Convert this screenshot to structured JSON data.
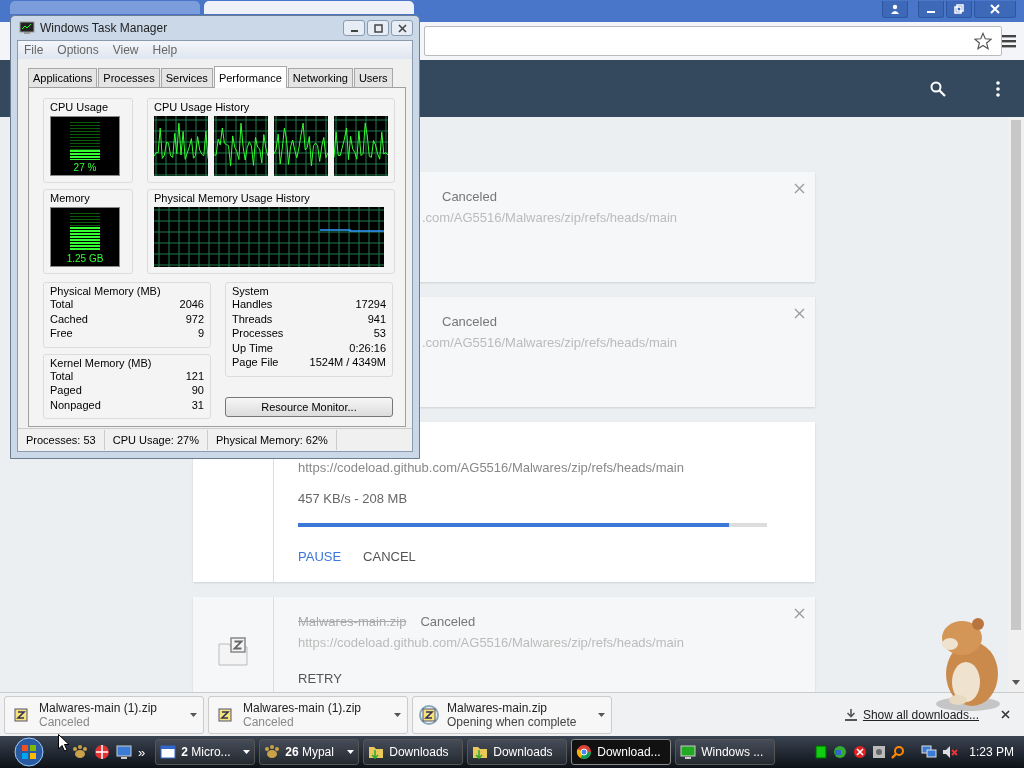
{
  "browser": {
    "downloads": [
      {
        "kind": "canceled",
        "status": "Canceled",
        "url": ".com/AG5516/Malwares/zip/refs/heads/main",
        "closable": true
      },
      {
        "kind": "canceled",
        "status": "Canceled",
        "url": ".com/AG5516/Malwares/zip/refs/heads/main",
        "closable": true
      },
      {
        "kind": "active",
        "url": "https://codeload.github.com/AG5516/Malwares/zip/refs/heads/main",
        "progress_text": "457 KB/s - 208 MB",
        "level": 0.92,
        "actions": [
          {
            "label": "PAUSE",
            "primary": true
          },
          {
            "label": "CANCEL",
            "primary": false
          }
        ]
      },
      {
        "kind": "canceled",
        "name": "Malwares-main.zip",
        "status": "Canceled",
        "url": "https://codeload.github.com/AG5516/Malwares/zip/refs/heads/main",
        "actions": [
          {
            "label": "RETRY",
            "primary": false
          }
        ],
        "closable": true
      }
    ],
    "shelf": {
      "items": [
        {
          "kind": "canceled",
          "name": "Malwares-main (1).zip",
          "status": "Canceled"
        },
        {
          "kind": "canceled",
          "name": "Malwares-main (1).zip",
          "status": "Canceled"
        },
        {
          "kind": "downloading",
          "name": "Malwares-main.zip",
          "status": "Opening when complete"
        }
      ],
      "link": "Show all downloads..."
    }
  },
  "task_manager": {
    "title": "Windows Task Manager",
    "menu": [
      "File",
      "Options",
      "View",
      "Help"
    ],
    "tabs": [
      {
        "label": "Applications",
        "selected": false
      },
      {
        "label": "Processes",
        "selected": false
      },
      {
        "label": "Services",
        "selected": false
      },
      {
        "label": "Performance",
        "selected": true
      },
      {
        "label": "Networking",
        "selected": false
      },
      {
        "label": "Users",
        "selected": false
      }
    ],
    "cpu": {
      "label": "CPU Usage",
      "reading": "27 %",
      "level": 0.27
    },
    "cpu_history": {
      "label": "CPU Usage History"
    },
    "memory": {
      "label": "Memory",
      "reading": "1.25 GB",
      "level": 0.62
    },
    "memory_history": {
      "label": "Physical Memory Usage History"
    },
    "physical_memory": {
      "title": "Physical Memory (MB)",
      "rows": [
        {
          "label": "Total",
          "value": "2046"
        },
        {
          "label": "Cached",
          "value": "972"
        },
        {
          "label": "Free",
          "value": "9"
        }
      ]
    },
    "kernel_memory": {
      "title": "Kernel Memory (MB)",
      "rows": [
        {
          "label": "Total",
          "value": "121"
        },
        {
          "label": "Paged",
          "value": "90"
        },
        {
          "label": "Nonpaged",
          "value": "31"
        }
      ]
    },
    "system": {
      "title": "System",
      "rows": [
        {
          "label": "Handles",
          "value": "17294"
        },
        {
          "label": "Threads",
          "value": "941"
        },
        {
          "label": "Processes",
          "value": "53"
        },
        {
          "label": "Up Time",
          "value": "0:26:16"
        },
        {
          "label": "Page File",
          "value": "1524M / 4349M"
        }
      ]
    },
    "button": "Resource Monitor...",
    "status_bar": [
      "Processes: 53",
      "CPU Usage: 27%",
      "Physical Memory: 62%"
    ]
  },
  "taskbar": {
    "overflow": "»",
    "items": [
      {
        "kind": "window",
        "label": "**2** Micro...",
        "grouped": true,
        "selected": false
      },
      {
        "kind": "app",
        "label": "**26** Mypal",
        "grouped": true,
        "selected": false
      },
      {
        "kind": "folder",
        "label": "Downloads",
        "grouped": false,
        "selected": false
      },
      {
        "kind": "folder",
        "label": "Downloads",
        "grouped": false,
        "selected": false
      },
      {
        "kind": "browser",
        "label": "Download...",
        "grouped": false,
        "selected": true
      },
      {
        "kind": "monitor",
        "label": "Windows ...",
        "grouped": false,
        "selected": false
      }
    ],
    "clock": "1:23 PM"
  }
}
